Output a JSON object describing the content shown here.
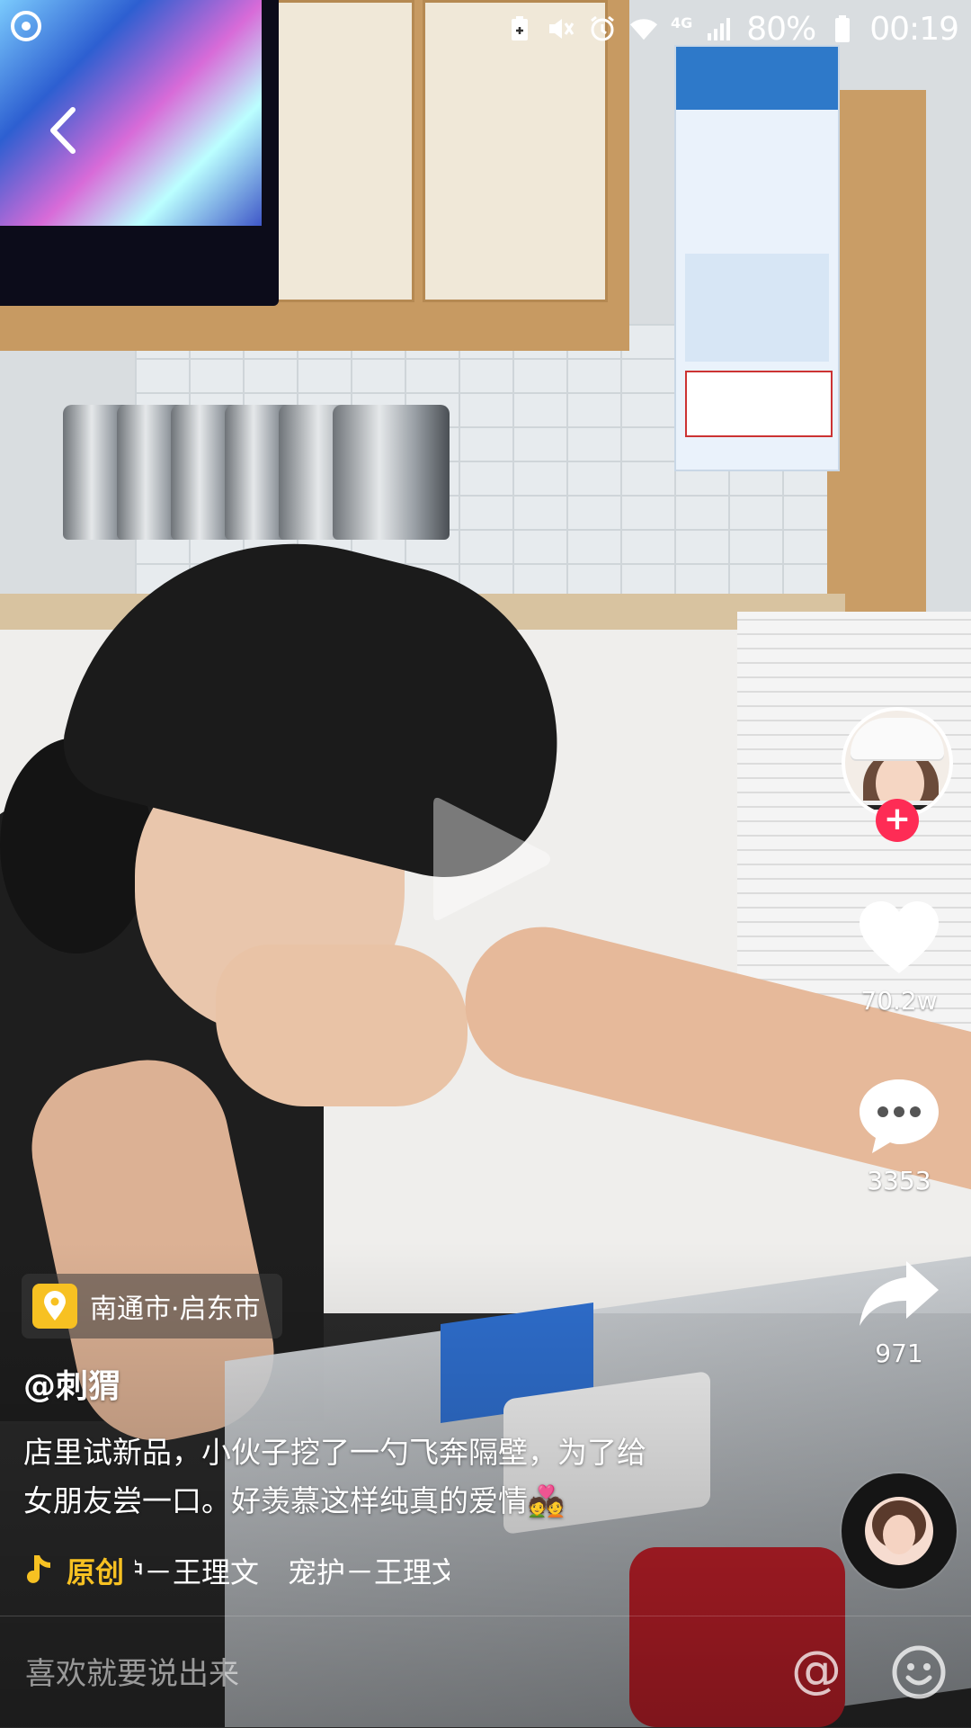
{
  "status_bar": {
    "network": "4G",
    "battery": "80%",
    "time": "00:19"
  },
  "video": {
    "location": "南通市·启东市",
    "author": "@刺猬",
    "caption_line1": "店里试新品，小伙子挖了一勺飞奔隔壁，为了给",
    "caption_line2": "女朋友尝一口。好羡慕这样纯真的爱情💑",
    "music_label": "原创",
    "music_track": "护－王理文　宠护－王理文"
  },
  "actions": {
    "likes": "70.2w",
    "comments": "3353",
    "shares": "971"
  },
  "comment_bar": {
    "placeholder": "喜欢就要说出来",
    "at_symbol": "@"
  },
  "colors": {
    "follow_badge": "#fe2c55",
    "accent_yellow": "#f7c122"
  },
  "icons": [
    "app-indicator-icon",
    "back-icon",
    "play-icon",
    "heart-icon",
    "comment-icon",
    "share-icon",
    "location-pin-icon",
    "music-note-icon",
    "emoji-icon"
  ]
}
